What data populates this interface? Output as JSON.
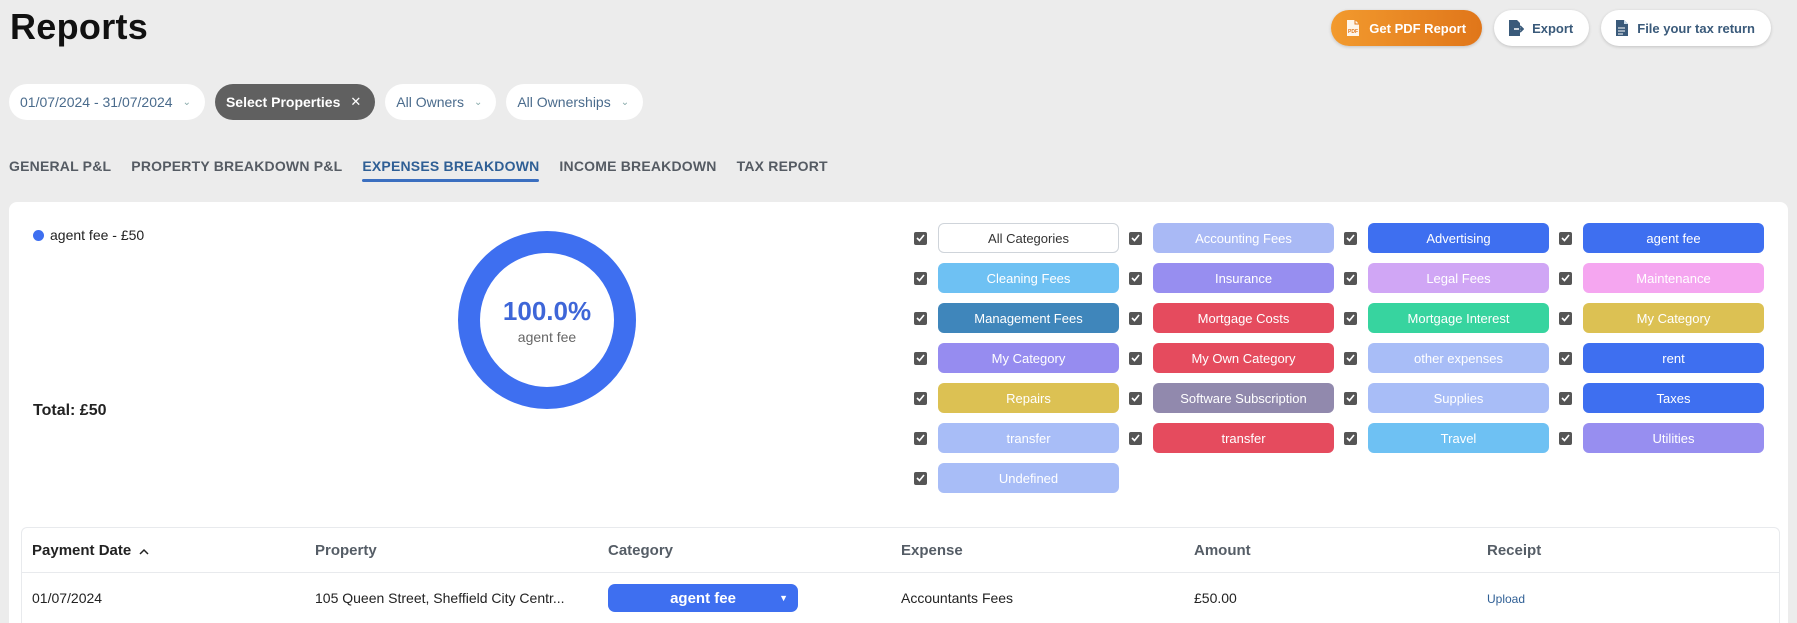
{
  "header": {
    "title": "Reports",
    "actions": {
      "pdf_label": "Get PDF Report",
      "export_label": "Export",
      "tax_label": "File your tax return"
    }
  },
  "filters": {
    "date_range": "01/07/2024 - 31/07/2024",
    "properties": "Select Properties",
    "owners": "All Owners",
    "ownerships": "All Ownerships"
  },
  "tabs": [
    {
      "label": "GENERAL P&L",
      "active": false
    },
    {
      "label": "PROPERTY BREAKDOWN P&L",
      "active": false
    },
    {
      "label": "EXPENSES BREAKDOWN",
      "active": true
    },
    {
      "label": "INCOME BREAKDOWN",
      "active": false
    },
    {
      "label": "TAX REPORT",
      "active": false
    }
  ],
  "breakdown": {
    "legend": "agent fee - £50",
    "total": "Total: £50",
    "donut_percent": "100.0%",
    "donut_label": "agent fee",
    "donut_color": "#3e6ff0",
    "donut_fraction": 1.0
  },
  "categories": [
    {
      "label": "All Categories",
      "color": "#ffffff",
      "text_color": "#333333",
      "outline": true
    },
    {
      "label": "Accounting Fees",
      "color": "#a9b9f5"
    },
    {
      "label": "Advertising",
      "color": "#3e6ff0"
    },
    {
      "label": "agent fee",
      "color": "#3e6ff0"
    },
    {
      "label": "Cleaning Fees",
      "color": "#6ec1f3"
    },
    {
      "label": "Insurance",
      "color": "#978ef0"
    },
    {
      "label": "Legal Fees",
      "color": "#d0a6f5"
    },
    {
      "label": "Maintenance",
      "color": "#f5a6f0"
    },
    {
      "label": "Management Fees",
      "color": "#3f86bb"
    },
    {
      "label": "Mortgage Costs",
      "color": "#e54b5e"
    },
    {
      "label": "Mortgage Interest",
      "color": "#37d49f"
    },
    {
      "label": "My Category",
      "color": "#dcc153"
    },
    {
      "label": "My Category",
      "color": "#968cf0"
    },
    {
      "label": "My Own Category",
      "color": "#e54b5e"
    },
    {
      "label": "other expenses",
      "color": "#a8bdf7"
    },
    {
      "label": "rent",
      "color": "#3e6ff0"
    },
    {
      "label": "Repairs",
      "color": "#dcc153"
    },
    {
      "label": "Software Subscription",
      "color": "#9189ad"
    },
    {
      "label": "Supplies",
      "color": "#a8bdf7"
    },
    {
      "label": "Taxes",
      "color": "#3e6ff0"
    },
    {
      "label": "transfer",
      "color": "#a8bdf7"
    },
    {
      "label": "transfer",
      "color": "#e54b5e"
    },
    {
      "label": "Travel",
      "color": "#6ec1f3"
    },
    {
      "label": "Utilities",
      "color": "#978ef0"
    },
    {
      "label": "Undefined",
      "color": "#a8bdf7"
    }
  ],
  "table": {
    "columns": [
      "Payment Date",
      "Property",
      "Category",
      "Expense",
      "Amount",
      "Receipt"
    ],
    "rows": [
      {
        "date": "01/07/2024",
        "property": "105 Queen Street, Sheffield City Centr...",
        "category": "agent fee",
        "expense": "Accountants Fees",
        "amount": "£50.00",
        "receipt": "Upload"
      }
    ]
  }
}
